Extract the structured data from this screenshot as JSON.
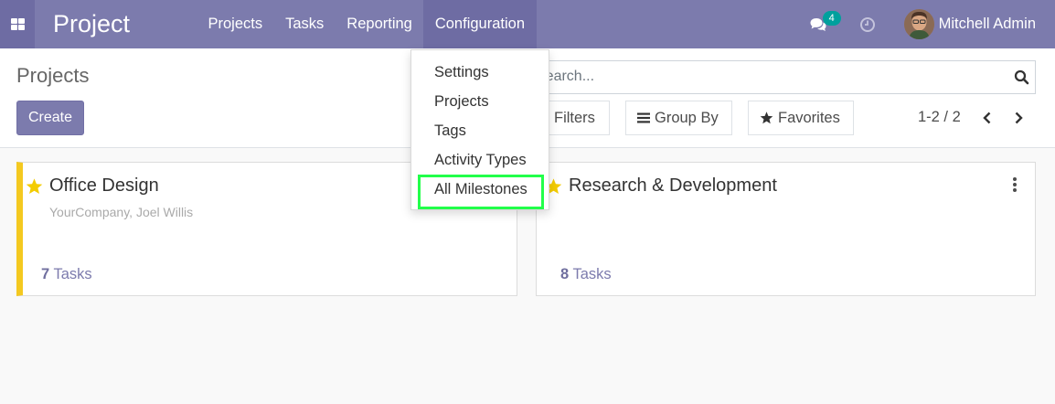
{
  "navbar": {
    "app_title": "Project",
    "menu": [
      "Projects",
      "Tasks",
      "Reporting",
      "Configuration"
    ],
    "active_menu": "Configuration",
    "chat_count": "4",
    "user_name": "Mitchell Admin",
    "bg_color": "#7c7bad"
  },
  "control_panel": {
    "title": "Projects",
    "create_label": "Create",
    "search_placeholder": "Search...",
    "filters_label": "Filters",
    "group_by_label": "Group By",
    "favorites_label": "Favorites",
    "pager": "1-2 / 2"
  },
  "config_dropdown": {
    "items": [
      "Settings",
      "Projects",
      "Tags",
      "Activity Types",
      "All Milestones"
    ],
    "highlighted": "All Milestones"
  },
  "projects": [
    {
      "name": "Office Design",
      "subtitle": "YourCompany, Joel Willis",
      "task_count": "7",
      "task_label": "Tasks",
      "color": "#f4c920"
    },
    {
      "name": "Research & Development",
      "subtitle": "",
      "task_count": "8",
      "task_label": "Tasks"
    }
  ]
}
